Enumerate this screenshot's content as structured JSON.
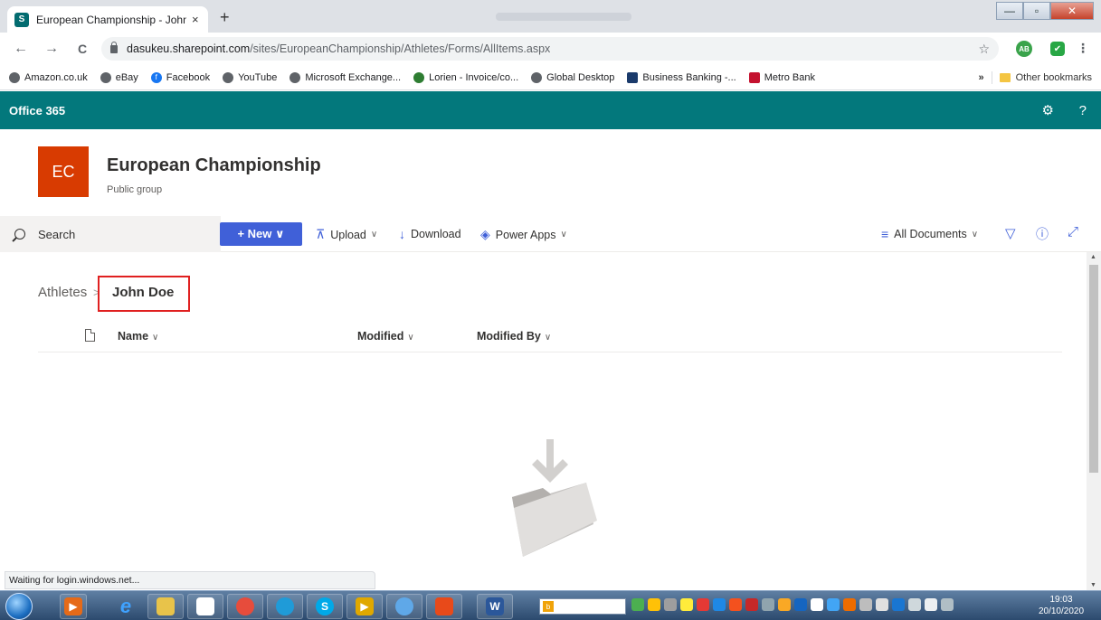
{
  "browser": {
    "tab_title": "European Championship - John D",
    "tab_close": "×",
    "new_tab": "+",
    "url_host": "dasukeu.sharepoint.com",
    "url_path": "/sites/EuropeanChampionship/Athletes/Forms/AllItems.aspx",
    "back": "←",
    "forward": "→",
    "reload": "C",
    "star": "☆",
    "ext_ab": "AB",
    "ext_shield": "✔",
    "menu": "⋮"
  },
  "bookmarks": [
    {
      "label": "Amazon.co.uk",
      "color": "#5f6368"
    },
    {
      "label": "eBay",
      "color": "#5f6368"
    },
    {
      "label": "Facebook",
      "color": "#1877f2"
    },
    {
      "label": "YouTube",
      "color": "#5f6368"
    },
    {
      "label": "Microsoft Exchange...",
      "color": "#5f6368"
    },
    {
      "label": "Lorien - Invoice/co...",
      "color": "#2e7d32"
    },
    {
      "label": "Global Desktop",
      "color": "#5f6368"
    },
    {
      "label": "Business Banking -...",
      "color": "#1a3a6b"
    },
    {
      "label": "Metro Bank",
      "color": "#c4122f"
    }
  ],
  "bookmarks_more": "»",
  "other_bookmarks": "Other bookmarks",
  "o365": {
    "brand": "Office 365",
    "gear": "⚙",
    "help": "?"
  },
  "site": {
    "logo": "EC",
    "title": "European Championship",
    "subtitle": "Public group",
    "logo_color": "#d83b01"
  },
  "commands": {
    "search": "Search",
    "new": "+ New ∨",
    "upload": "Upload",
    "download": "Download",
    "power_apps": "Power Apps",
    "view": "All Documents",
    "chev": "∨",
    "upload_icon": "⊼",
    "download_icon": "↓",
    "power_icon": "◈",
    "view_icon": "≡",
    "filter_icon": "▽",
    "info_icon": "ⓘ",
    "expand_icon": "⤢"
  },
  "breadcrumb": {
    "root": "Athletes",
    "separator": ">",
    "current": "John Doe"
  },
  "columns": {
    "name": "Name",
    "modified": "Modified",
    "modified_by": "Modified By",
    "chev": "∨"
  },
  "status": "Waiting for login.windows.net...",
  "clock": {
    "time": "19:03",
    "date": "20/10/2020"
  },
  "accent": "#03787c",
  "button_color": "#4060d8"
}
